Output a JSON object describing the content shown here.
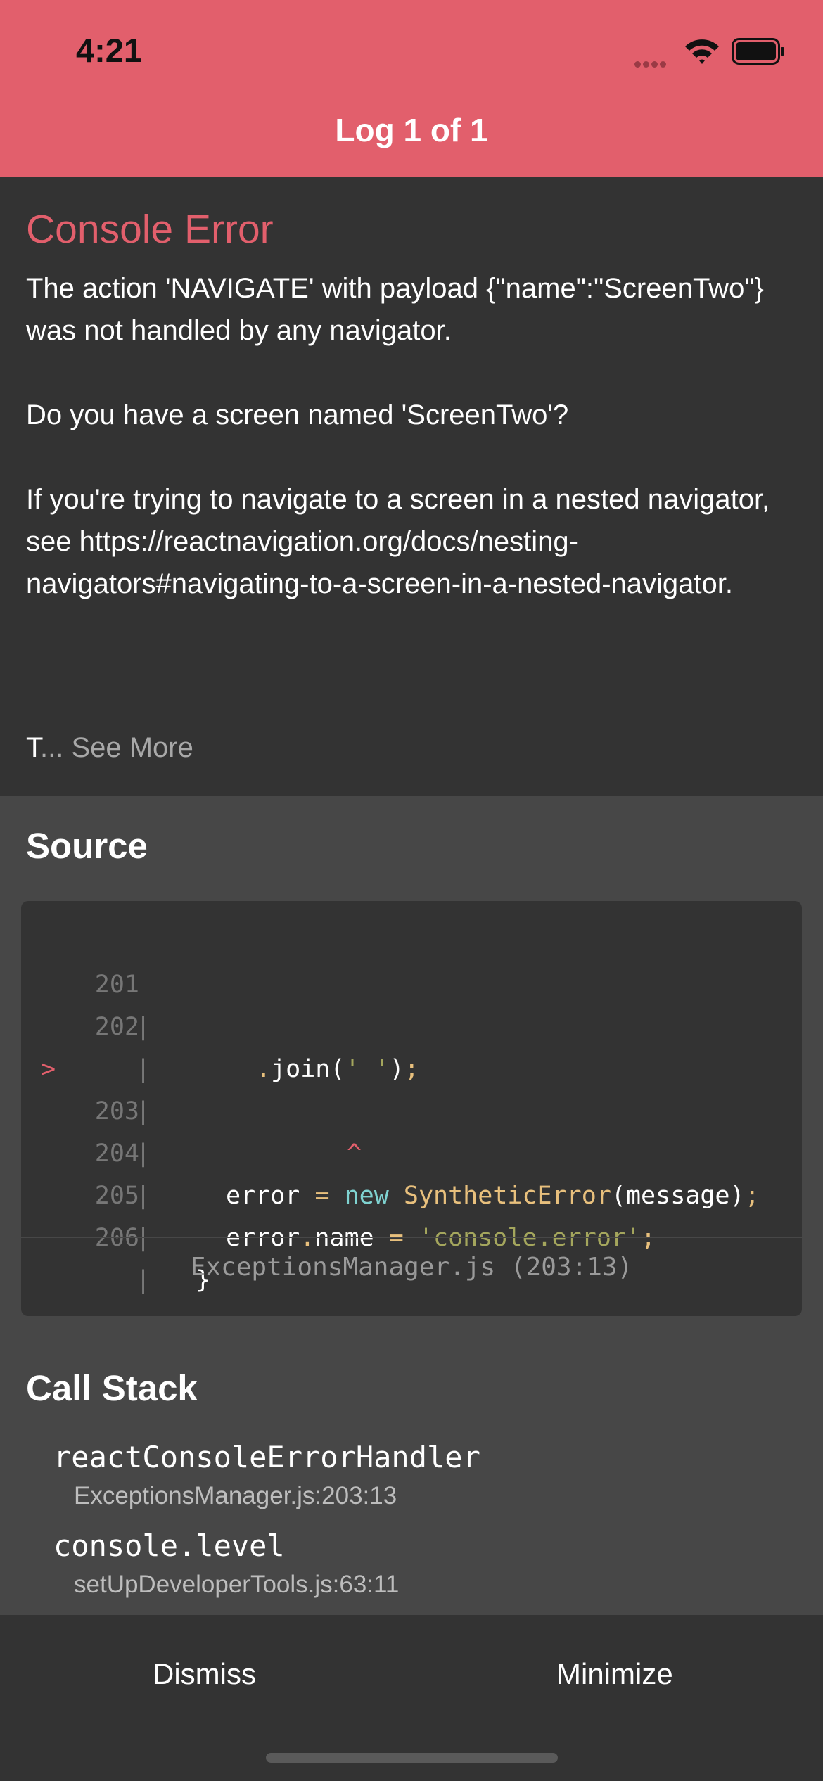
{
  "status_bar": {
    "time": "4:21"
  },
  "header": {
    "title": "Log 1 of 1"
  },
  "error": {
    "title": "Console Error",
    "message_paragraphs": [
      "The action 'NAVIGATE' with payload {\"name\":\"ScreenTwo\"} was not handled by any navigator.",
      "Do you have a screen named 'ScreenTwo'?",
      "If you're trying to navigate to a screen in a nested navigator, see https://reactnavigation.org/docs/nesting-navigators#navigating-to-a-screen-in-a-nested-navigator."
    ],
    "truncated_prefix": "T",
    "see_more_label": "... See More"
  },
  "source": {
    "title": "Source",
    "lines": [
      {
        "num": "201",
        "marker": "",
        "code": ".join(' ');"
      },
      {
        "num": "202",
        "marker": "",
        "code": ""
      },
      {
        "num": "203",
        "marker": ">",
        "code": "error = new SyntheticError(message);"
      },
      {
        "num": "",
        "marker": "",
        "code": "^"
      },
      {
        "num": "204",
        "marker": "",
        "code": "error.name = 'console.error';"
      },
      {
        "num": "205",
        "marker": "",
        "code": "}"
      },
      {
        "num": "206",
        "marker": "",
        "code": ""
      }
    ],
    "file_location": "ExceptionsManager.js (203:13)"
  },
  "call_stack": {
    "title": "Call Stack",
    "frames": [
      {
        "name": "reactConsoleErrorHandler",
        "location": "ExceptionsManager.js:203:13"
      },
      {
        "name": "console.level",
        "location": "setUpDeveloperTools.js:63:11"
      }
    ]
  },
  "footer": {
    "dismiss_label": "Dismiss",
    "minimize_label": "Minimize"
  },
  "colors": {
    "header_bg": "#e25f6c",
    "panel_bg": "#333333",
    "body_bg": "#474747",
    "error_red": "#e25f6c"
  }
}
